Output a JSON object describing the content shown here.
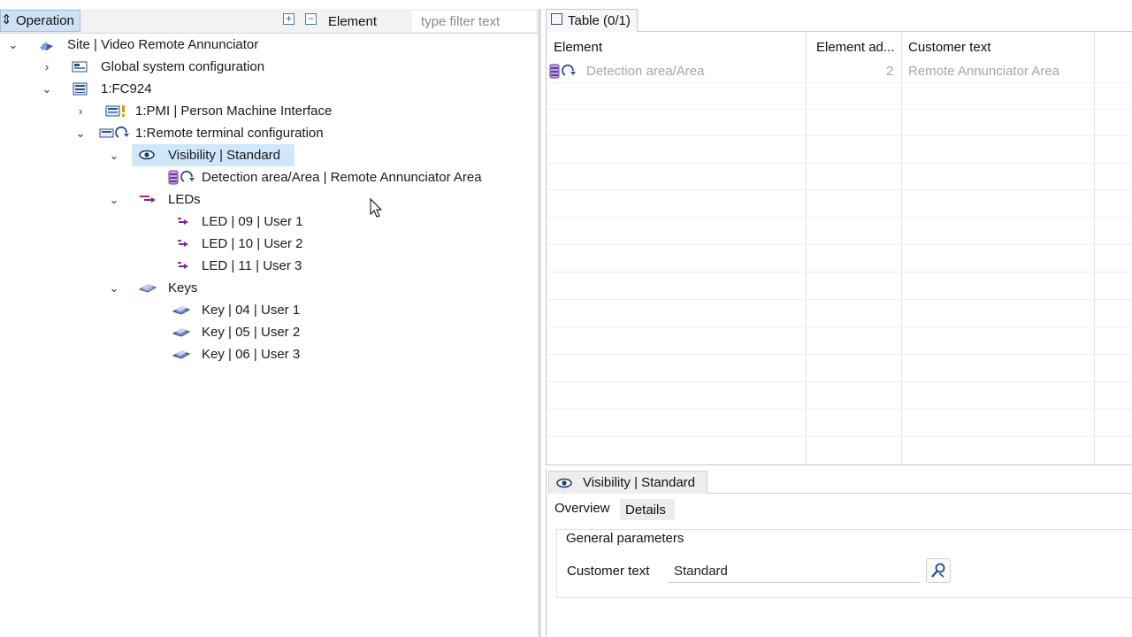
{
  "left_toolbar": {
    "operation_label": "Operation",
    "element_label": "Element",
    "filter_placeholder": "type filter text"
  },
  "tree": [
    {
      "label": "Site | Video Remote Annunciator",
      "icon": "site-icon",
      "toggle": "expanded"
    },
    {
      "label": "Global system configuration",
      "icon": "global-config-icon",
      "toggle": "collapsed"
    },
    {
      "label": "1:FC924",
      "icon": "panel-icon",
      "toggle": "expanded"
    },
    {
      "label": "1:PMI | Person Machine Interface",
      "icon": "pmi-icon",
      "toggle": "collapsed"
    },
    {
      "label": "1:Remote terminal configuration",
      "icon": "remote-terminal-icon",
      "toggle": "expanded"
    },
    {
      "label": "Visibility | Standard",
      "icon": "eye-icon",
      "toggle": "expanded",
      "selected": true
    },
    {
      "label": "Detection area/Area | Remote Annunciator Area",
      "icon": "detection-area-icon",
      "toggle": "none"
    },
    {
      "label": "LEDs",
      "icon": "leds-icon",
      "toggle": "expanded"
    },
    {
      "label": "LED | 09 | User 1",
      "icon": "led-icon",
      "toggle": "none"
    },
    {
      "label": "LED | 10 | User 2",
      "icon": "led-icon",
      "toggle": "none"
    },
    {
      "label": "LED | 11 | User 3",
      "icon": "led-icon",
      "toggle": "none"
    },
    {
      "label": "Keys",
      "icon": "keys-icon",
      "toggle": "expanded"
    },
    {
      "label": "Key | 04 | User 1",
      "icon": "key-icon",
      "toggle": "none"
    },
    {
      "label": "Key | 05 | User 2",
      "icon": "key-icon",
      "toggle": "none"
    },
    {
      "label": "Key | 06 | User 3",
      "icon": "key-icon",
      "toggle": "none"
    }
  ],
  "table": {
    "tab_title": "Table (0/1)",
    "columns": [
      "Element",
      "Element ad...",
      "Customer text"
    ],
    "rows": [
      {
        "element": "Detection area/Area",
        "element_address": "2",
        "customer_text": "Remote Annunciator Area"
      }
    ]
  },
  "properties": {
    "tab_title": "Visibility | Standard",
    "tabs": [
      "Overview",
      "Details"
    ],
    "group_title": "General parameters",
    "customer_text_label": "Customer text",
    "customer_text_value": "Standard"
  },
  "colors": {
    "selection": "#cfe6fb",
    "operation_tab": "#cfe2f5",
    "disabled_text": "#a6a6a6"
  }
}
